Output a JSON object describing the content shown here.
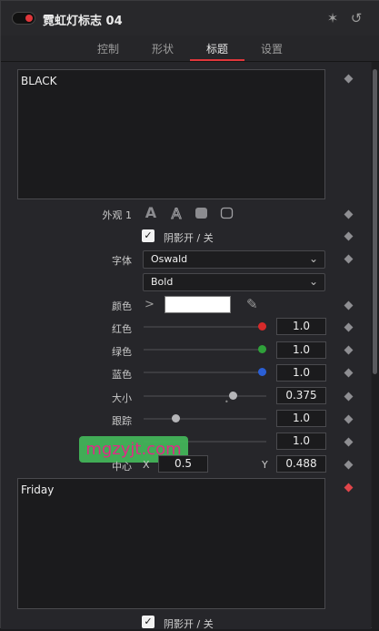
{
  "header": {
    "title": "霓虹灯标志 04",
    "icons": [
      "magic-wand-icon",
      "reset-icon"
    ]
  },
  "tabs": [
    {
      "label": "控制"
    },
    {
      "label": "形状"
    },
    {
      "label": "标题"
    },
    {
      "label": "设置"
    }
  ],
  "active_tab": "标题",
  "text1": {
    "value": "BLACK"
  },
  "text2": {
    "value": "Friday"
  },
  "appearance": {
    "label": "外观 1",
    "icons": [
      "text-fill-icon",
      "text-outline-icon",
      "rounded-fill-icon",
      "rounded-outline-icon"
    ]
  },
  "shadow": {
    "label": "阴影开 / 关",
    "checked": true
  },
  "shadow2": {
    "label": "阴影开 / 关",
    "checked": true
  },
  "font": {
    "label": "字体",
    "value": "Oswald"
  },
  "weight": {
    "value": "Bold"
  },
  "color": {
    "label": "颜色",
    "expand": ">",
    "swatch": "#ffffff"
  },
  "sliders": {
    "red": {
      "label": "红色",
      "value": "1.0",
      "fraction": 1.0,
      "color": "#d62a2a"
    },
    "green": {
      "label": "绿色",
      "value": "1.0",
      "fraction": 1.0,
      "color": "#2fa13a"
    },
    "blue": {
      "label": "蓝色",
      "value": "1.0",
      "fraction": 1.0,
      "color": "#2a5fd6"
    },
    "size": {
      "label": "大小",
      "value": "0.375",
      "fraction": 0.72
    },
    "tracking": {
      "label": "跟踪",
      "value": "1.0",
      "fraction": 0.25
    },
    "hidden": {
      "value": "1.0"
    }
  },
  "center": {
    "label": "中心",
    "x_label": "X",
    "x": "0.5",
    "y_label": "Y",
    "y": "0.488"
  },
  "watermark": "mgzyjt.com"
}
